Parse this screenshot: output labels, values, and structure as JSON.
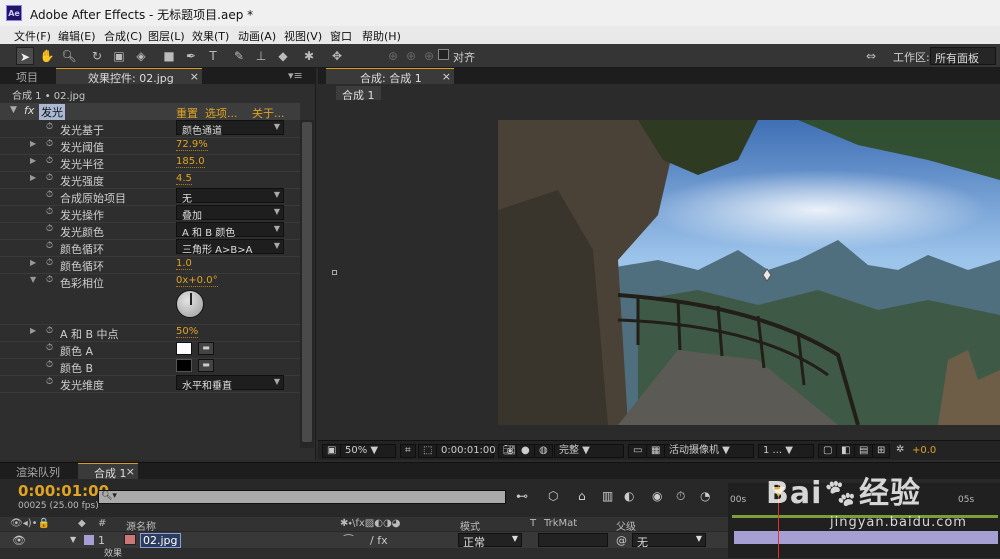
{
  "titlebar": {
    "title": "Adobe After Effects - 无标题项目.aep *",
    "app_icon_text": "Ae"
  },
  "menu": [
    "文件(F)",
    "编辑(E)",
    "合成(C)",
    "图层(L)",
    "效果(T)",
    "动画(A)",
    "视图(V)",
    "窗口",
    "帮助(H)"
  ],
  "toolbar": {
    "snap_label": "对齐",
    "workspace_label": "工作区:",
    "workspace_value": "所有面板"
  },
  "left_panel": {
    "tabs": [
      "项目",
      "效果控件: 02.jpg"
    ],
    "breadcrumb": "合成 1 • 02.jpg",
    "effect": {
      "name": "发光",
      "reset": "重置",
      "options": "选项...",
      "about": "关于..."
    },
    "properties": [
      {
        "label": "发光基于",
        "kind": "dropdown",
        "value": "颜色通道",
        "expandable": false
      },
      {
        "label": "发光阈值",
        "kind": "number",
        "value": "72.9%",
        "expandable": true
      },
      {
        "label": "发光半径",
        "kind": "number",
        "value": "185.0",
        "expandable": true
      },
      {
        "label": "发光强度",
        "kind": "number",
        "value": "4.5",
        "expandable": true
      },
      {
        "label": "合成原始项目",
        "kind": "dropdown",
        "value": "无",
        "expandable": false
      },
      {
        "label": "发光操作",
        "kind": "dropdown",
        "value": "叠加",
        "expandable": false
      },
      {
        "label": "发光颜色",
        "kind": "dropdown",
        "value": "A 和 B 颜色",
        "expandable": false
      },
      {
        "label": "颜色循环",
        "kind": "dropdown",
        "value": "三角形 A>B>A",
        "expandable": false
      },
      {
        "label": "颜色循环",
        "kind": "number",
        "value": "1.0",
        "expandable": true
      },
      {
        "label": "色彩相位",
        "kind": "angle",
        "value": "0x+0.0°",
        "expandable": true
      },
      {
        "label": "A 和 B 中点",
        "kind": "number",
        "value": "50%",
        "expandable": true
      },
      {
        "label": "颜色 A",
        "kind": "color",
        "value": "#ffffff",
        "expandable": false
      },
      {
        "label": "颜色 B",
        "kind": "color",
        "value": "#000000",
        "expandable": false
      },
      {
        "label": "发光维度",
        "kind": "dropdown",
        "value": "水平和垂直",
        "expandable": false
      }
    ]
  },
  "comp_panel": {
    "tab": "合成: 合成 1",
    "subtab": "合成 1",
    "zoom": "50%",
    "timecode": "0:00:01:00",
    "resolution": "完整",
    "camera": "活动摄像机",
    "views": "1 ...",
    "exposure": "+0.0"
  },
  "timeline": {
    "tabs": [
      "渲染队列",
      "合成 1"
    ],
    "timecode": "0:00:01:00",
    "frame_info": "00025 (25.00 fps)",
    "search_placeholder": "",
    "columns": {
      "hash": "#",
      "source": "源名称",
      "mode": "模式",
      "t": "T",
      "trkmat": "TrkMat",
      "parent": "父级"
    },
    "layer": {
      "index": "1",
      "name": "02.jpg",
      "mode": "正常",
      "parent": "无"
    },
    "sublabel": "效果",
    "ruler": {
      "start": "00s",
      "mark": "05s"
    }
  },
  "watermark": {
    "brand": "Bai",
    "brand2": "经验",
    "url": "jingyan.baidu.com"
  }
}
